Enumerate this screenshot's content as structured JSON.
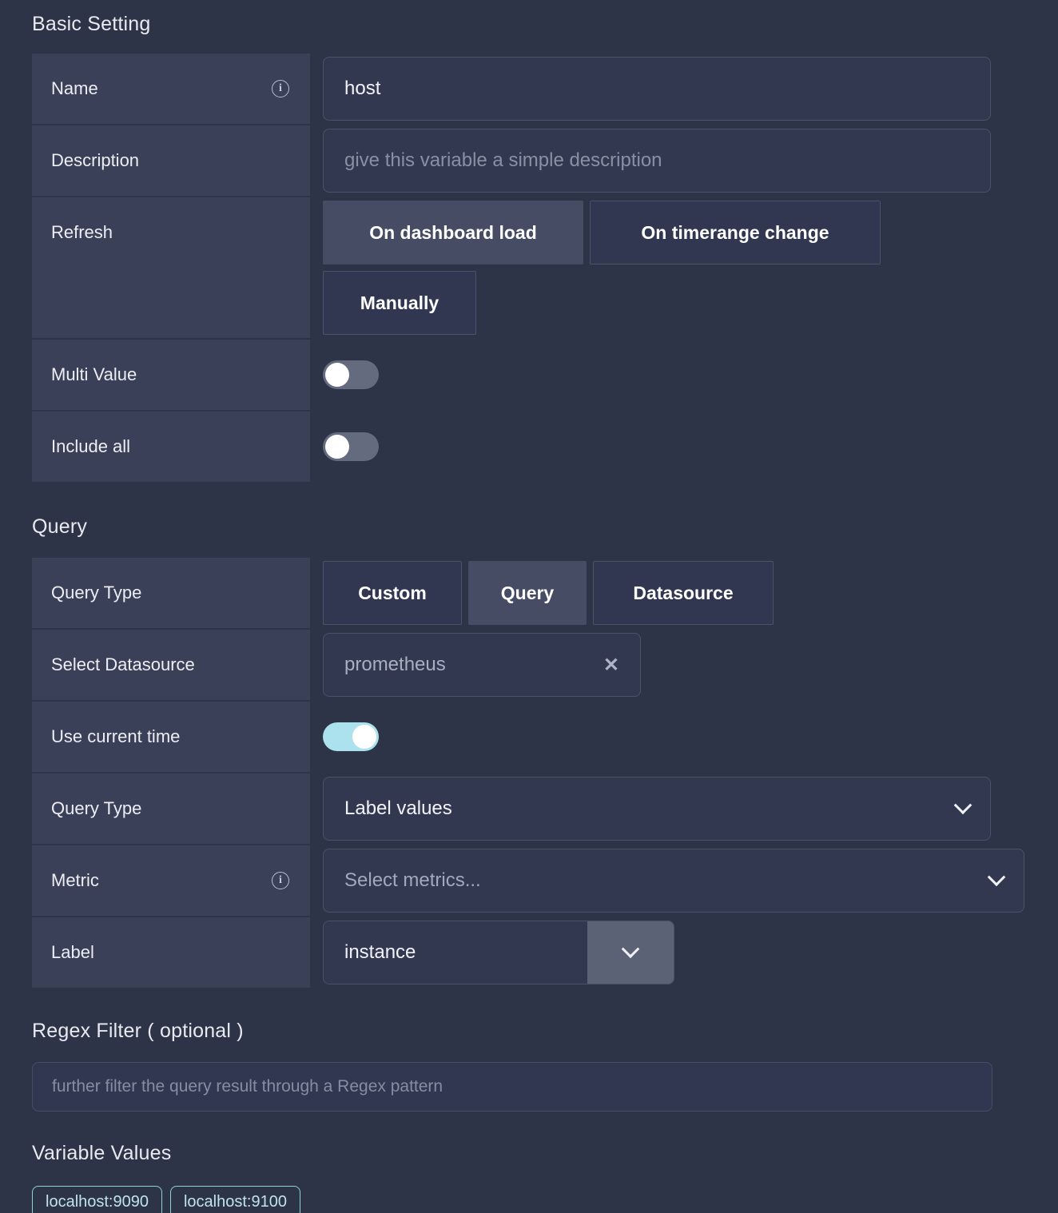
{
  "basic_setting": {
    "heading": "Basic Setting",
    "name": {
      "label": "Name",
      "info_icon": "info-circle-icon",
      "value": "host"
    },
    "description": {
      "label": "Description",
      "placeholder": "give this variable a simple description",
      "value": ""
    },
    "refresh": {
      "label": "Refresh",
      "options": [
        {
          "label": "On dashboard load",
          "selected": true
        },
        {
          "label": "On timerange change",
          "selected": false
        },
        {
          "label": "Manually",
          "selected": false
        }
      ]
    },
    "multi_value": {
      "label": "Multi Value",
      "enabled": false
    },
    "include_all": {
      "label": "Include all",
      "enabled": false
    }
  },
  "query": {
    "heading": "Query",
    "query_type_buttons": {
      "label": "Query Type",
      "options": [
        {
          "label": "Custom",
          "selected": false
        },
        {
          "label": "Query",
          "selected": true
        },
        {
          "label": "Datasource",
          "selected": false
        }
      ]
    },
    "select_datasource": {
      "label": "Select Datasource",
      "value": "prometheus",
      "clear_icon": "close-x-icon"
    },
    "use_current_time": {
      "label": "Use current time",
      "enabled": true
    },
    "query_type_dropdown": {
      "label": "Query Type",
      "value": "Label values",
      "chevron_icon": "chevron-down-icon"
    },
    "metric": {
      "label": "Metric",
      "info_icon": "info-circle-icon",
      "placeholder": "Select metrics...",
      "value": "",
      "chevron_icon": "chevron-down-icon"
    },
    "label_field": {
      "label": "Label",
      "value": "instance",
      "chevron_icon": "chevron-down-icon"
    }
  },
  "regex_filter": {
    "heading": "Regex Filter ( optional )",
    "placeholder": "further filter the query result through a Regex pattern",
    "value": ""
  },
  "variable_values": {
    "heading": "Variable Values",
    "chips": [
      "localhost:9090",
      "localhost:9100"
    ]
  },
  "colors": {
    "page_background": "#2e3448",
    "row_label_background": "#3a4057",
    "input_background": "#323850",
    "input_border": "#4b5168",
    "selected_button_background": "#454c63",
    "toggle_on": "#ace2ee",
    "toggle_off": "#646b7e",
    "chip_accent": "#8fd0dd",
    "split_button_background": "#5b6276"
  }
}
